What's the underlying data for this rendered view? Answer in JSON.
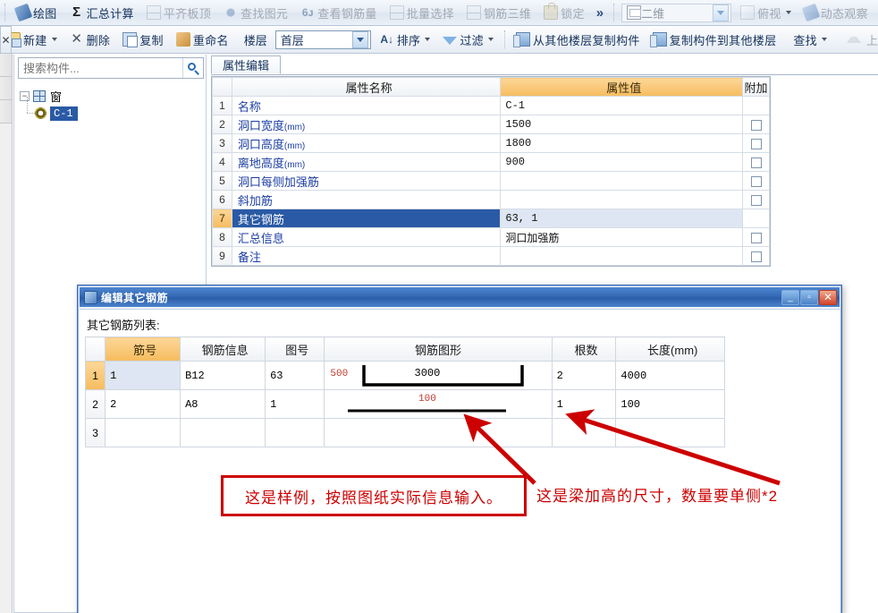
{
  "toolbar_top": {
    "items": [
      {
        "label": "绘图",
        "icon": "pen-icon",
        "enabled": true,
        "has_caret": false
      },
      {
        "label": "汇总计算",
        "icon": "sigma-icon",
        "enabled": true,
        "has_caret": false
      },
      {
        "label": "平齐板顶",
        "icon": "slab-align-icon",
        "enabled": false,
        "has_caret": false
      },
      {
        "label": "查找图元",
        "icon": "find-element-icon",
        "enabled": false,
        "has_caret": false
      },
      {
        "label": "查看钢筋量",
        "icon": "view-rebar-icon",
        "enabled": false,
        "has_caret": false
      },
      {
        "label": "批量选择",
        "icon": "batch-select-icon",
        "enabled": false,
        "has_caret": false
      },
      {
        "label": "钢筋三维",
        "icon": "rebar-3d-icon",
        "enabled": false,
        "has_caret": false
      },
      {
        "label": "锁定",
        "icon": "lock-icon",
        "enabled": false,
        "has_caret": false
      }
    ],
    "overflow_label": "»",
    "view_combo": {
      "value": "二维",
      "icon": "cube-icon"
    },
    "view_items": [
      {
        "label": "俯视",
        "icon": "top-view-icon",
        "has_caret": true
      },
      {
        "label": "动态观察",
        "icon": "orbit-icon",
        "has_caret": false
      }
    ]
  },
  "toolbar_second": {
    "close_strip_label": "✕",
    "items": [
      {
        "label": "新建",
        "icon": "new-icon",
        "enabled": true,
        "has_caret": true
      },
      {
        "label": "删除",
        "icon": "delete-icon",
        "enabled": true,
        "has_caret": false
      },
      {
        "label": "复制",
        "icon": "copy-icon",
        "enabled": true,
        "has_caret": false
      },
      {
        "label": "重命名",
        "icon": "rename-icon",
        "enabled": true,
        "has_caret": false
      }
    ],
    "floor_label": "楼层",
    "floor_value": "首层",
    "sort_label": "排序",
    "filter_label": "过滤",
    "copy_from_other_floor": "从其他楼层复制构件",
    "copy_to_other_floor": "复制构件到其他楼层",
    "find_label": "查找",
    "move_up_label": "上移"
  },
  "left_panel": {
    "search_placeholder": "搜索构件...",
    "search_value": "",
    "search_icon": "magnifier-icon",
    "tree": {
      "root_label": "窗",
      "root_expander": "−",
      "children": [
        {
          "label": "C-1",
          "selected": true
        }
      ]
    }
  },
  "property_panel": {
    "tab_label": "属性编辑",
    "headers": [
      "",
      "属性名称",
      "属性值",
      "附加"
    ],
    "rows": [
      {
        "idx": "1",
        "name": "名称",
        "unit": "",
        "value": "C-1",
        "attach": false,
        "has_attach": false,
        "selected": false
      },
      {
        "idx": "2",
        "name": "洞口宽度",
        "unit": "(mm)",
        "value": "1500",
        "attach": false,
        "has_attach": true,
        "selected": false
      },
      {
        "idx": "3",
        "name": "洞口高度",
        "unit": "(mm)",
        "value": "1800",
        "attach": false,
        "has_attach": true,
        "selected": false
      },
      {
        "idx": "4",
        "name": "离地高度",
        "unit": "(mm)",
        "value": "900",
        "attach": false,
        "has_attach": true,
        "selected": false
      },
      {
        "idx": "5",
        "name": "洞口每侧加强筋",
        "unit": "",
        "value": "",
        "attach": false,
        "has_attach": true,
        "selected": false
      },
      {
        "idx": "6",
        "name": "斜加筋",
        "unit": "",
        "value": "",
        "attach": false,
        "has_attach": true,
        "selected": false
      },
      {
        "idx": "7",
        "name": "其它钢筋",
        "unit": "",
        "value": "63, 1",
        "attach": false,
        "has_attach": false,
        "selected": true
      },
      {
        "idx": "8",
        "name": "汇总信息",
        "unit": "",
        "value": "洞口加强筋",
        "attach": false,
        "has_attach": true,
        "selected": false
      },
      {
        "idx": "9",
        "name": "备注",
        "unit": "",
        "value": "",
        "attach": false,
        "has_attach": true,
        "selected": false
      }
    ]
  },
  "dialog": {
    "title": "编辑其它钢筋",
    "app_icon": "app-icon",
    "minimize_label": "_",
    "maximize_label": "▫",
    "close_label": "✕",
    "list_label": "其它钢筋列表:",
    "headers": [
      "",
      "筋号",
      "钢筋信息",
      "图号",
      "钢筋图形",
      "根数",
      "长度(mm)"
    ],
    "length_unit": "(mm)",
    "rows": [
      {
        "idx": "1",
        "num": "1",
        "info": "B12",
        "tu": "63",
        "shape_type": "u-bracket",
        "shape_lead": "500",
        "shape_value": "3000",
        "count": "2",
        "length": "4000",
        "selected": true
      },
      {
        "idx": "2",
        "num": "2",
        "info": "A8",
        "tu": "1",
        "shape_type": "straight-line",
        "shape_lead": "",
        "shape_value": "100",
        "count": "1",
        "length": "100",
        "selected": false
      },
      {
        "idx": "3",
        "num": "",
        "info": "",
        "tu": "",
        "shape_type": "none",
        "shape_lead": "",
        "shape_value": "",
        "count": "",
        "length": "",
        "selected": false
      }
    ]
  },
  "annotations": {
    "box_text": "这是样例，按照图纸实际信息输入。",
    "note_text": "这是梁加高的尺寸，数量要单侧*2",
    "color": "#cc0000"
  }
}
